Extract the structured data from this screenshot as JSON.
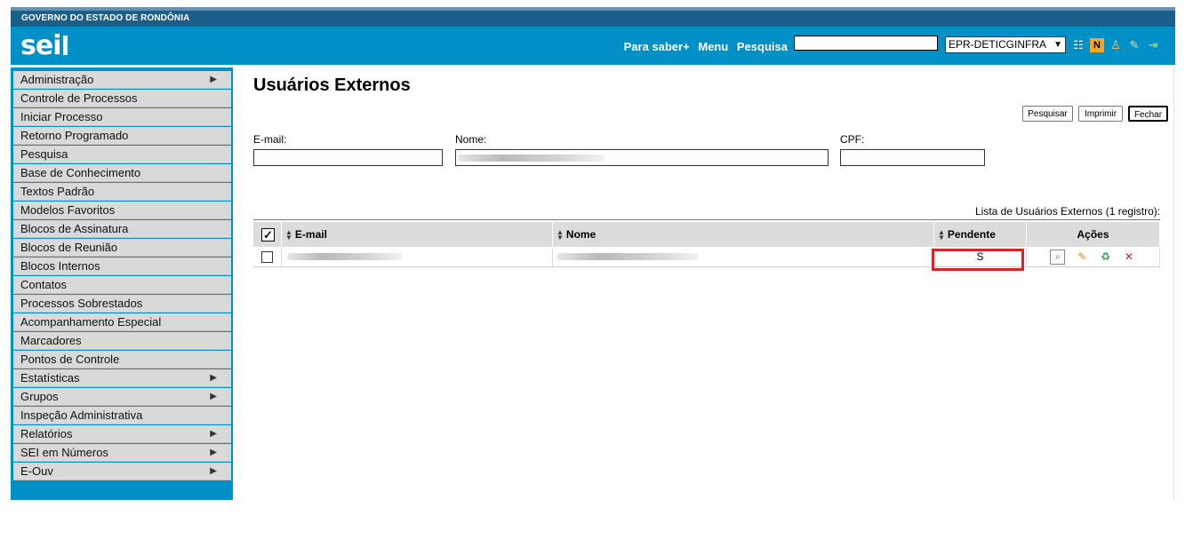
{
  "header": {
    "government": "GOVERNO DO ESTADO DE RONDÔNIA",
    "logo": "sei",
    "links": [
      "Para saber+",
      "Menu",
      "Pesquisa"
    ],
    "unit_select": "EPR-DETICGINFRA",
    "icons": [
      "list-icon",
      "notes-icon",
      "user-icon",
      "tools-icon",
      "logout-icon"
    ]
  },
  "sidebar": {
    "items": [
      {
        "label": "Administração",
        "has_submenu": true
      },
      {
        "label": "Controle de Processos",
        "has_submenu": false
      },
      {
        "label": "Iniciar Processo",
        "has_submenu": false
      },
      {
        "label": "Retorno Programado",
        "has_submenu": false
      },
      {
        "label": "Pesquisa",
        "has_submenu": false
      },
      {
        "label": "Base de Conhecimento",
        "has_submenu": false
      },
      {
        "label": "Textos Padrão",
        "has_submenu": false
      },
      {
        "label": "Modelos Favoritos",
        "has_submenu": false
      },
      {
        "label": "Blocos de Assinatura",
        "has_submenu": false
      },
      {
        "label": "Blocos de Reunião",
        "has_submenu": false
      },
      {
        "label": "Blocos Internos",
        "has_submenu": false
      },
      {
        "label": "Contatos",
        "has_submenu": false
      },
      {
        "label": "Processos Sobrestados",
        "has_submenu": false
      },
      {
        "label": "Acompanhamento Especial",
        "has_submenu": false
      },
      {
        "label": "Marcadores",
        "has_submenu": false
      },
      {
        "label": "Pontos de Controle",
        "has_submenu": false
      },
      {
        "label": "Estatísticas",
        "has_submenu": true
      },
      {
        "label": "Grupos",
        "has_submenu": true
      },
      {
        "label": "Inspeção Administrativa",
        "has_submenu": false
      },
      {
        "label": "Relatórios",
        "has_submenu": true
      },
      {
        "label": "SEI em Números",
        "has_submenu": true
      },
      {
        "label": "E-Ouv",
        "has_submenu": true
      }
    ]
  },
  "page": {
    "title": "Usuários Externos",
    "buttons": {
      "search": "Pesquisar",
      "print": "Imprimir",
      "close": "Fechar"
    },
    "filters": {
      "email_label": "E-mail:",
      "name_label": "Nome:",
      "cpf_label": "CPF:"
    },
    "list_caption": "Lista de Usuários Externos (1 registro):",
    "table": {
      "columns": [
        "E-mail",
        "Nome",
        "Pendente",
        "Ações"
      ],
      "rows": [
        {
          "pendente": "S",
          "actions": [
            "view-icon",
            "edit-icon",
            "reactivate-icon",
            "delete-icon"
          ]
        }
      ]
    }
  },
  "colors": {
    "header": "#0090c8",
    "topbar": "#1a5e8a",
    "highlight": "#d8232a"
  }
}
